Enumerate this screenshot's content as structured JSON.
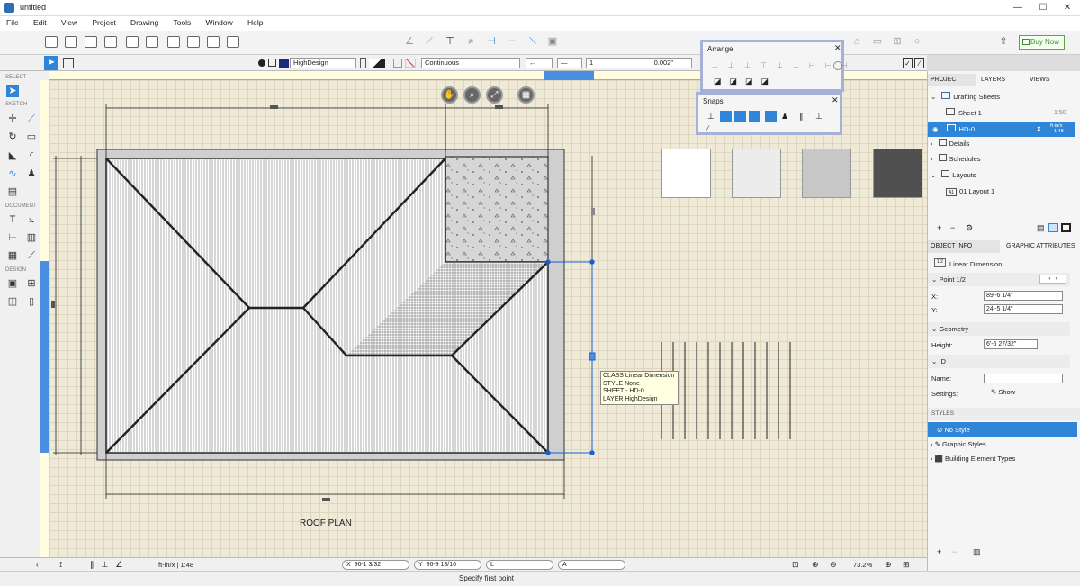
{
  "window": {
    "title": "untitled",
    "min": "—",
    "max": "☐",
    "close": "✕"
  },
  "menu": [
    "File",
    "Edit",
    "View",
    "Project",
    "Drawing",
    "Tools",
    "Window",
    "Help"
  ],
  "toolbar": {
    "buy_now": "Buy Now"
  },
  "propbar": {
    "layer": "HighDesign",
    "linetype": "Continuous",
    "weight": "1",
    "thickness": "0.002\""
  },
  "leftpanel": {
    "select": "SELECT",
    "sketch": "SKETCH",
    "document": "DOCUMENT",
    "design": "DESIGN"
  },
  "canvas": {
    "roof_label": "ROOF PLAN"
  },
  "tooltip": {
    "line1": "CLASS Linear Dimension",
    "line2": "STYLE None",
    "line3": "SHEET - HD-0",
    "line4": "LAYER HighDesign"
  },
  "arrange": {
    "title": "Arrange",
    "close": "✕"
  },
  "snaps": {
    "title": "Snaps",
    "close": "✕"
  },
  "statusbar": {
    "scale": "ft-in/x | 1:48",
    "x_label": "X",
    "x_value": "96-1 3/32",
    "y_label": "Y",
    "y_value": "36-9 13/16",
    "l_label": "L",
    "a_label": "A",
    "zoom": "73.2%"
  },
  "hint": "Specify first point",
  "rightpanel": {
    "tabs": {
      "project": "PROJECT",
      "layers": "LAYERS",
      "views": "VIEWS"
    },
    "tree": {
      "drafting_sheets": "Drafting Sheets",
      "sheet1": "Sheet 1",
      "sheet1_scale": "1:50",
      "hd0": "HD-0",
      "hd0_unit": "ft-in/x",
      "hd0_scale": "1:48",
      "details": "Details",
      "schedules": "Schedules",
      "layouts": "Layouts",
      "layout1": "01 Layout 1",
      "layout1_prefix": "A1"
    },
    "obj_tabs": {
      "object_info": "OBJECT INFO",
      "graphic_attributes": "GRAPHIC ATTRIBUTES"
    },
    "object_name": "Linear Dimension",
    "point_section": "Point 1/2",
    "x_label": "X:",
    "x_value": "89'-6 1/4\"",
    "y_label": "Y:",
    "y_value": "24'-5 1/4\"",
    "geometry_section": "Geometry",
    "height_label": "Height:",
    "height_value": "6'-6 27/32\"",
    "id_section": "ID",
    "name_label": "Name:",
    "settings_label": "Settings:",
    "show_button": "Show",
    "styles_title": "STYLES",
    "styles": {
      "no_style": "No Style",
      "graphic_styles": "Graphic Styles",
      "building_types": "Building Element Types"
    }
  },
  "colors": {
    "accent": "#2f86d8",
    "selection": "#cde4fa",
    "canvas": "#efe9d8"
  }
}
